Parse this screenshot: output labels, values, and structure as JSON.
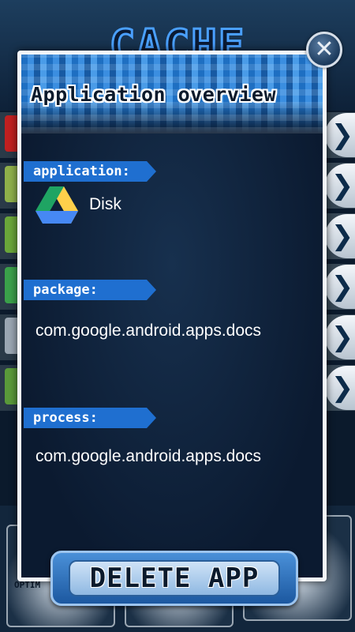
{
  "background": {
    "title": "CACHE",
    "bottom_label": "OPTIM",
    "arrow_glyph": "❯"
  },
  "dialog": {
    "title": "Application overview",
    "close_glyph": "✕",
    "sections": {
      "application": {
        "label": "application:",
        "app_name": "Disk",
        "icon": "google-drive-icon"
      },
      "package": {
        "label": "package:",
        "value": "com.google.android.apps.docs"
      },
      "process": {
        "label": "process:",
        "value": "com.google.android.apps.docs"
      }
    },
    "delete_button": "DELETE APP"
  },
  "colors": {
    "label_blue": "#1f6fd0",
    "dialog_border": "#f4f6f9",
    "drive_green": "#1fa463",
    "drive_yellow": "#ffd04b",
    "drive_blue": "#4688f4"
  }
}
